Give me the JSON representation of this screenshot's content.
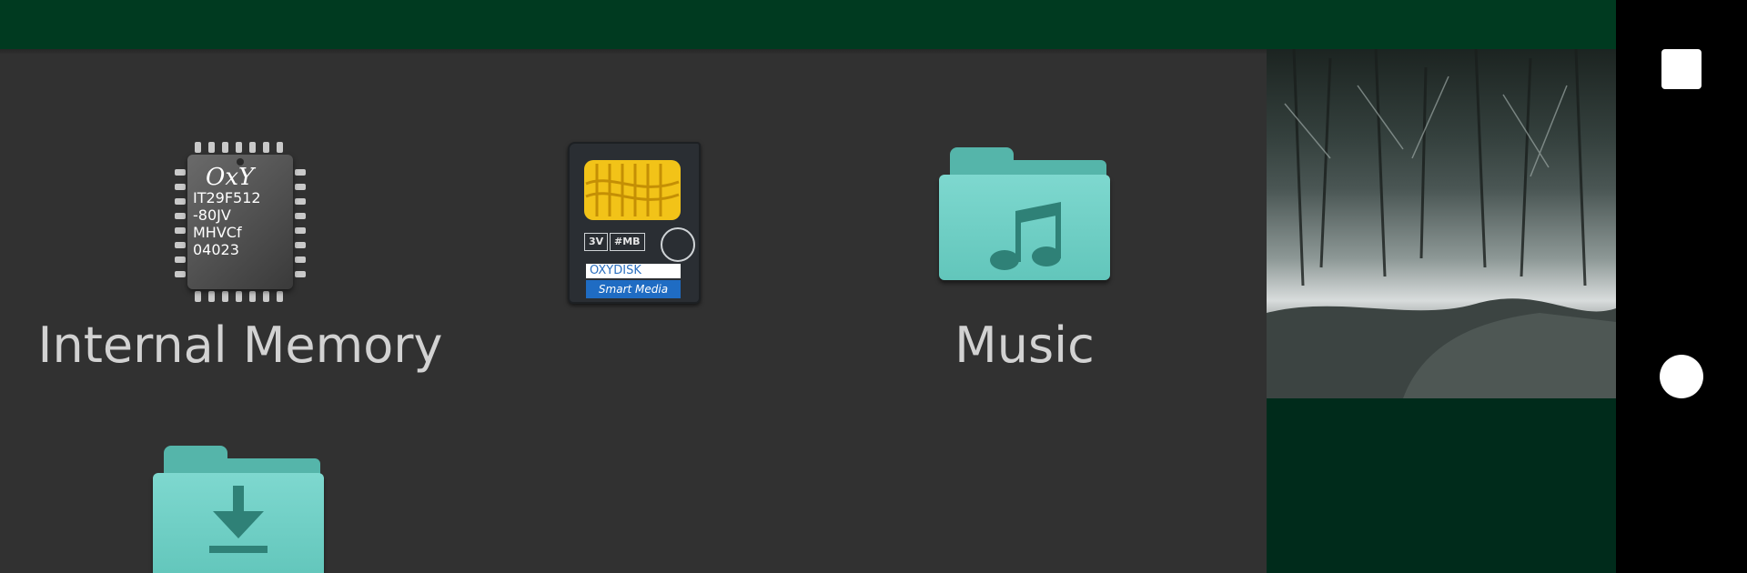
{
  "tiles": {
    "internal_memory": {
      "label": "Internal Memory",
      "chip_logo": "OxY",
      "chip_lines": [
        "IT29F512",
        "-80JV",
        "MHVCf",
        "04023"
      ]
    },
    "smart_media": {
      "badge_voltage": "3V",
      "badge_size": "#MB",
      "brand": "OXYDISK",
      "type": "Smart Media"
    },
    "music": {
      "label": "Music"
    }
  },
  "icons": {
    "music_folder": "music-note-icon",
    "download_folder": "download-icon"
  },
  "colors": {
    "appbar": "#003a20",
    "background": "#313131",
    "folder": "#62c6bb",
    "label": "#d2d2d2"
  }
}
